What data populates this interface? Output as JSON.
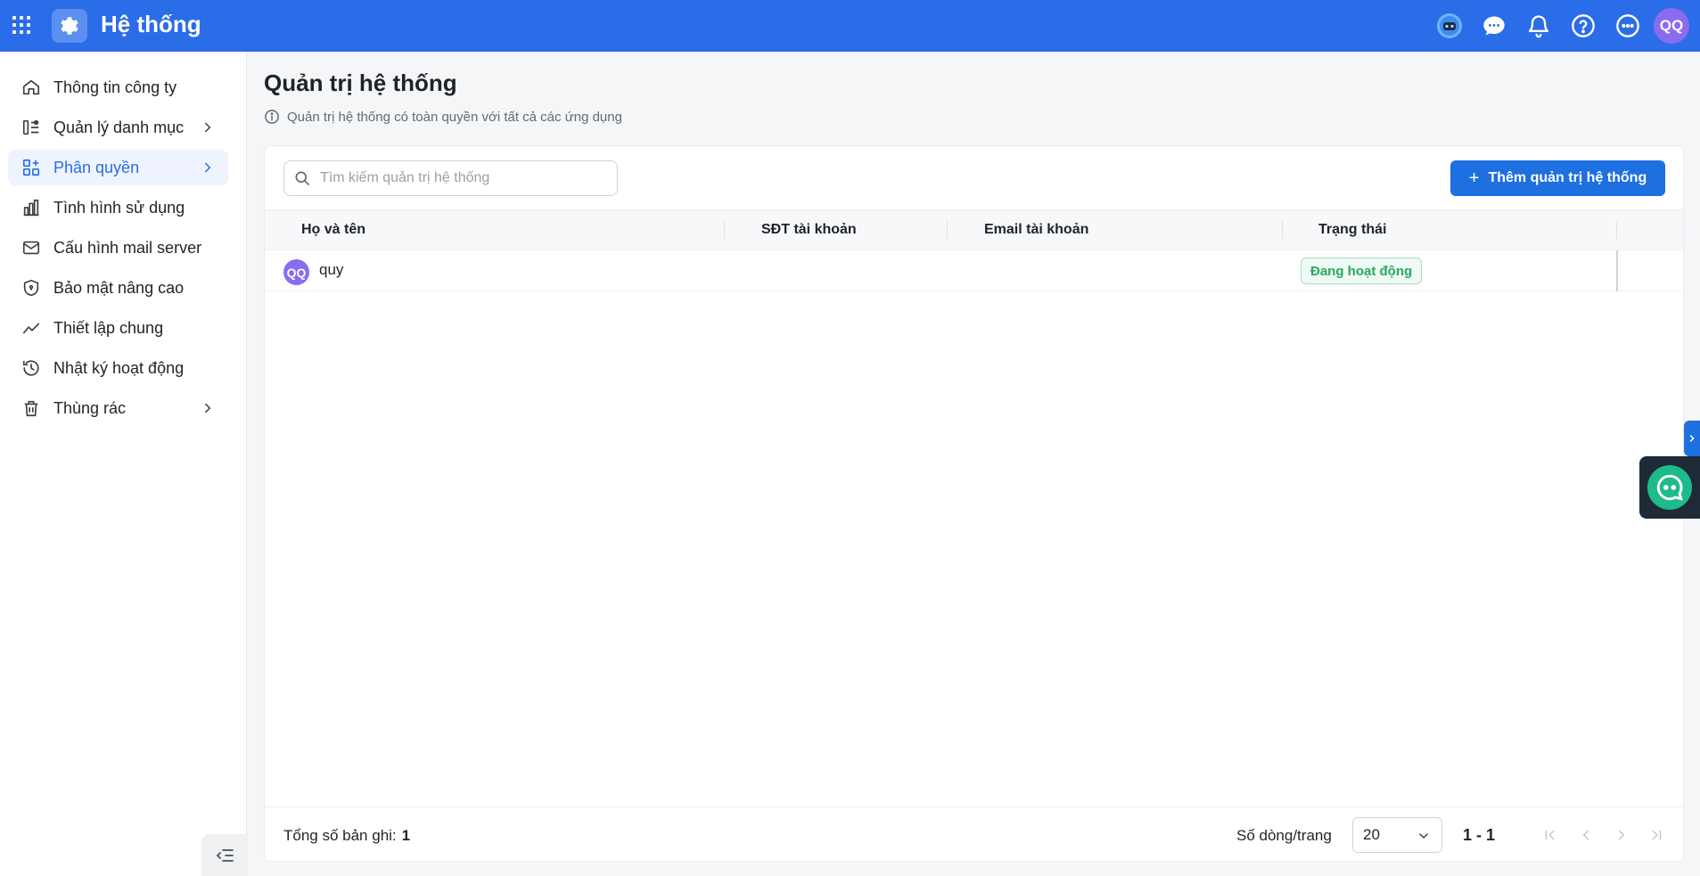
{
  "header": {
    "app_title": "Hệ thống",
    "user_initials": "QQ",
    "icons": [
      "apps-grid-icon",
      "gear-icon",
      "robot-icon",
      "chat-icon",
      "bell-icon",
      "help-icon",
      "more-icon"
    ]
  },
  "sidebar": {
    "items": [
      {
        "label": "Thông tin công ty",
        "icon": "home-icon"
      },
      {
        "label": "Quản lý danh mục",
        "icon": "category-icon"
      },
      {
        "label": "Phân quyền",
        "icon": "permission-icon"
      },
      {
        "label": "Tình hình sử dụng",
        "icon": "bar-chart-icon"
      },
      {
        "label": "Cấu hình mail server",
        "icon": "mail-icon"
      },
      {
        "label": "Bảo mật nâng cao",
        "icon": "shield-icon"
      },
      {
        "label": "Thiết lập chung",
        "icon": "trend-icon"
      },
      {
        "label": "Nhật ký hoạt động",
        "icon": "history-icon"
      },
      {
        "label": "Thùng rác",
        "icon": "trash-icon"
      }
    ],
    "active_label": "Phân quyền"
  },
  "main": {
    "title": "Quản trị hệ thống",
    "description": "Quản trị hệ thống có toàn quyền với tất cả các ứng dụng",
    "search": {
      "placeholder": "Tìm kiếm quản trị hệ thống",
      "value": ""
    },
    "add_button_label": "Thêm quản trị hệ thống",
    "table": {
      "columns": [
        "Họ và tên",
        "SĐT tài khoản",
        "Email tài khoản",
        "Trạng thái"
      ],
      "rows": [
        {
          "initials": "QQ",
          "name": "quy",
          "phone": "",
          "email": "",
          "status": "Đang hoạt động"
        }
      ]
    },
    "footer": {
      "total_label": "Tổng số bản ghi:",
      "total_value": "1",
      "rows_per_page_label": "Số dòng/trang",
      "rows_per_page_value": "20",
      "range": "1 - 1"
    }
  },
  "colors": {
    "primary": "#2b6de8",
    "button": "#1e6fe0",
    "status_green": "#27a85f",
    "avatar_purple": "#8b6bf0",
    "chat_green": "#1fba8c"
  }
}
